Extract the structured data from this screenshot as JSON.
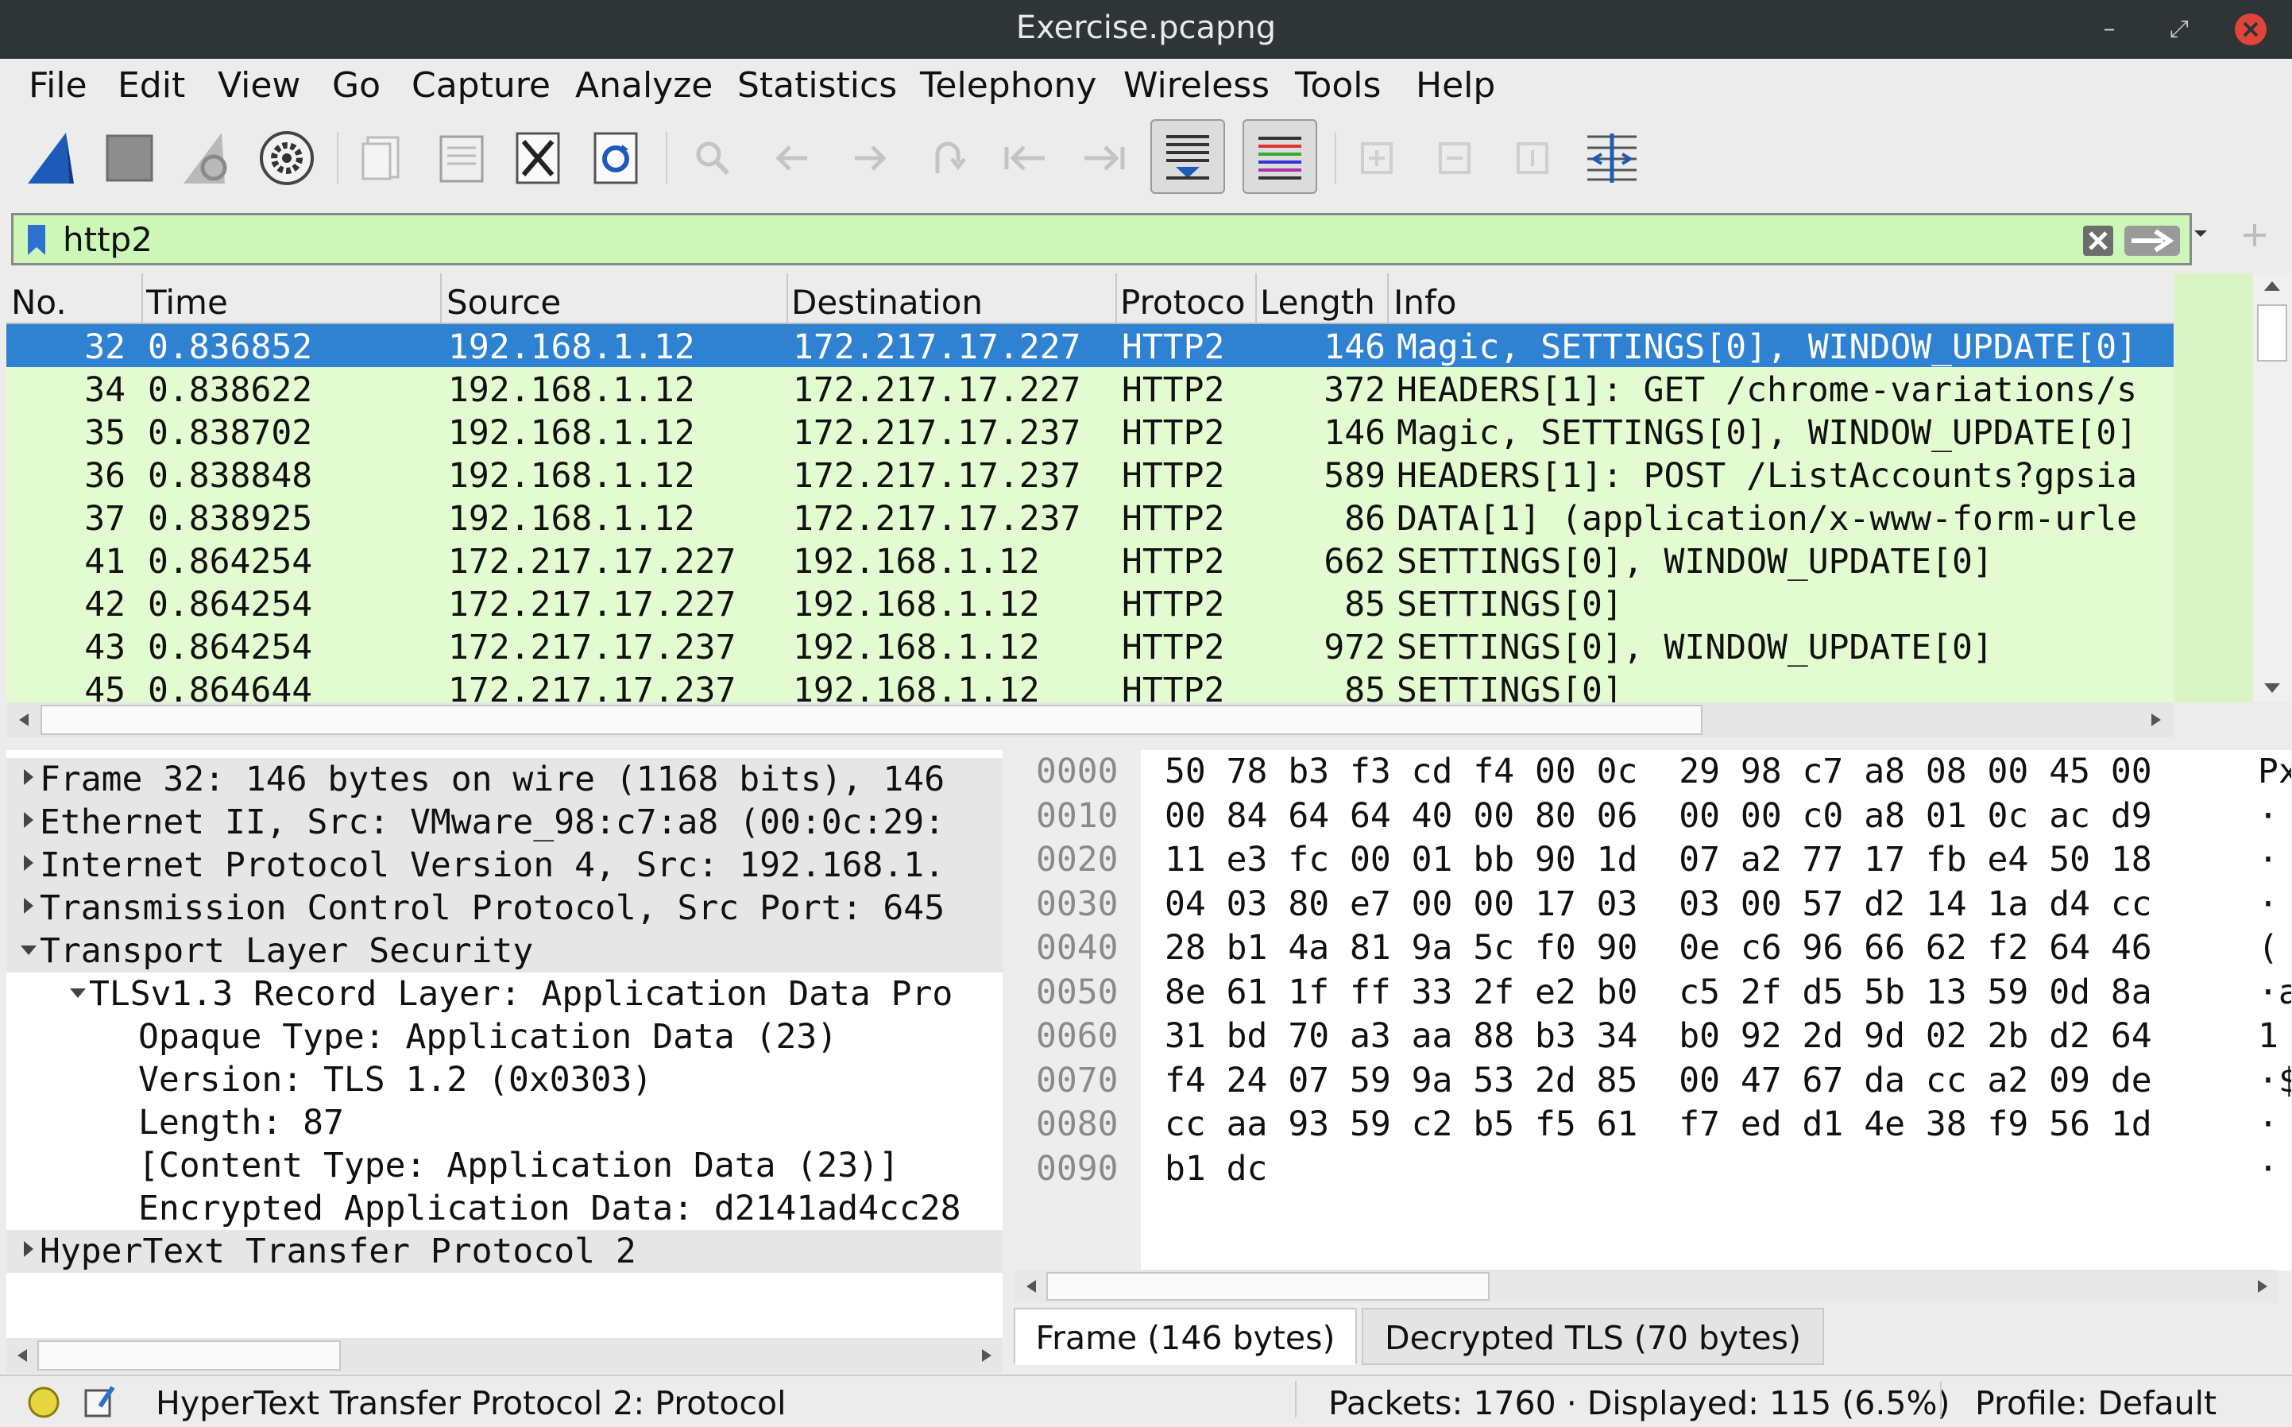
{
  "window": {
    "title": "Exercise.pcapng"
  },
  "menu": [
    "File",
    "Edit",
    "View",
    "Go",
    "Capture",
    "Analyze",
    "Statistics",
    "Telephony",
    "Wireless",
    "Tools",
    "Help"
  ],
  "toolbar": {
    "icons": [
      "shark-start-icon",
      "stop-icon",
      "restart-icon",
      "capture-options-icon",
      "open-file-icon",
      "save-file-icon",
      "close-file-icon",
      "reload-icon",
      "find-icon",
      "back-icon",
      "forward-icon",
      "go-to-packet-icon",
      "first-packet-icon",
      "last-packet-icon",
      "autoscroll-icon",
      "colorize-icon",
      "zoom-in-icon",
      "zoom-out-icon",
      "normal-size-icon",
      "resize-columns-icon"
    ]
  },
  "filter": {
    "value": "http2"
  },
  "packet_list": {
    "columns": [
      "No.",
      "Time",
      "Source",
      "Destination",
      "Protoco",
      "Length",
      "Info"
    ],
    "rows": [
      {
        "no": "32",
        "time": "0.836852",
        "src": "192.168.1.12",
        "dst": "172.217.17.227",
        "proto": "HTTP2",
        "len": "146",
        "info": "Magic, SETTINGS[0], WINDOW_UPDATE[0]"
      },
      {
        "no": "34",
        "time": "0.838622",
        "src": "192.168.1.12",
        "dst": "172.217.17.227",
        "proto": "HTTP2",
        "len": "372",
        "info": "HEADERS[1]: GET /chrome-variations/s"
      },
      {
        "no": "35",
        "time": "0.838702",
        "src": "192.168.1.12",
        "dst": "172.217.17.237",
        "proto": "HTTP2",
        "len": "146",
        "info": "Magic, SETTINGS[0], WINDOW_UPDATE[0]"
      },
      {
        "no": "36",
        "time": "0.838848",
        "src": "192.168.1.12",
        "dst": "172.217.17.237",
        "proto": "HTTP2",
        "len": "589",
        "info": "HEADERS[1]: POST /ListAccounts?gpsia"
      },
      {
        "no": "37",
        "time": "0.838925",
        "src": "192.168.1.12",
        "dst": "172.217.17.237",
        "proto": "HTTP2",
        "len": "86",
        "info": "DATA[1] (application/x-www-form-urle"
      },
      {
        "no": "41",
        "time": "0.864254",
        "src": "172.217.17.227",
        "dst": "192.168.1.12",
        "proto": "HTTP2",
        "len": "662",
        "info": "SETTINGS[0], WINDOW_UPDATE[0]"
      },
      {
        "no": "42",
        "time": "0.864254",
        "src": "172.217.17.227",
        "dst": "192.168.1.12",
        "proto": "HTTP2",
        "len": "85",
        "info": "SETTINGS[0]"
      },
      {
        "no": "43",
        "time": "0.864254",
        "src": "172.217.17.237",
        "dst": "192.168.1.12",
        "proto": "HTTP2",
        "len": "972",
        "info": "SETTINGS[0], WINDOW_UPDATE[0]"
      },
      {
        "no": "45",
        "time": "0.864644",
        "src": "172.217.17.237",
        "dst": "192.168.1.12",
        "proto": "HTTP2",
        "len": "85",
        "info": "SETTINGS[0]"
      }
    ]
  },
  "details": [
    {
      "text": "Frame 32: 146 bytes on wire (1168 bits), 146",
      "state": "collapsed",
      "indent": 0
    },
    {
      "text": "Ethernet II, Src: VMware_98:c7:a8 (00:0c:29:",
      "state": "collapsed",
      "indent": 0
    },
    {
      "text": "Internet Protocol Version 4, Src: 192.168.1.",
      "state": "collapsed",
      "indent": 0
    },
    {
      "text": "Transmission Control Protocol, Src Port: 645",
      "state": "collapsed",
      "indent": 0
    },
    {
      "text": "Transport Layer Security",
      "state": "expanded",
      "indent": 0
    },
    {
      "text": "TLSv1.3 Record Layer: Application Data Pro",
      "state": "expanded",
      "indent": 1
    },
    {
      "text": "Opaque Type: Application Data (23)",
      "state": "leaf",
      "indent": 2
    },
    {
      "text": "Version: TLS 1.2 (0x0303)",
      "state": "leaf",
      "indent": 2
    },
    {
      "text": "Length: 87",
      "state": "leaf",
      "indent": 2
    },
    {
      "text": "[Content Type: Application Data (23)]",
      "state": "leaf",
      "indent": 2
    },
    {
      "text": "Encrypted Application Data: d2141ad4cc28",
      "state": "leaf",
      "indent": 2
    },
    {
      "text": "HyperText Transfer Protocol 2",
      "state": "collapsed",
      "indent": 0
    }
  ],
  "hex": [
    {
      "off": "0000",
      "bytes": "50 78 b3 f3 cd f4 00 0c  29 98 c7 a8 08 00 45 00",
      "ascii": "Px"
    },
    {
      "off": "0010",
      "bytes": "00 84 64 64 40 00 80 06  00 00 c0 a8 01 0c ac d9",
      "ascii": "·"
    },
    {
      "off": "0020",
      "bytes": "11 e3 fc 00 01 bb 90 1d  07 a2 77 17 fb e4 50 18",
      "ascii": "·"
    },
    {
      "off": "0030",
      "bytes": "04 03 80 e7 00 00 17 03  03 00 57 d2 14 1a d4 cc",
      "ascii": "·"
    },
    {
      "off": "0040",
      "bytes": "28 b1 4a 81 9a 5c f0 90  0e c6 96 66 62 f2 64 46",
      "ascii": "("
    },
    {
      "off": "0050",
      "bytes": "8e 61 1f ff 33 2f e2 b0  c5 2f d5 5b 13 59 0d 8a",
      "ascii": "·a"
    },
    {
      "off": "0060",
      "bytes": "31 bd 70 a3 aa 88 b3 34  b0 92 2d 9d 02 2b d2 64",
      "ascii": "1"
    },
    {
      "off": "0070",
      "bytes": "f4 24 07 59 9a 53 2d 85  00 47 67 da cc a2 09 de",
      "ascii": "·$"
    },
    {
      "off": "0080",
      "bytes": "cc aa 93 59 c2 b5 f5 61  f7 ed d1 4e 38 f9 56 1d",
      "ascii": "·"
    },
    {
      "off": "0090",
      "bytes": "b1 dc",
      "ascii": "·"
    }
  ],
  "hex_tabs": [
    "Frame (146 bytes)",
    "Decrypted TLS (70 bytes)"
  ],
  "status": {
    "text": "HyperText Transfer Protocol 2: Protocol",
    "packets": "Packets: 1760 · Displayed: 115 (6.5%)",
    "profile": "Profile: Default"
  },
  "colors": {
    "selection": "#2f82d2",
    "row_bg": "#e3fbd0",
    "filter_bg": "#cdf7b8",
    "titlebar": "#2f3437",
    "close": "#e0443a"
  }
}
